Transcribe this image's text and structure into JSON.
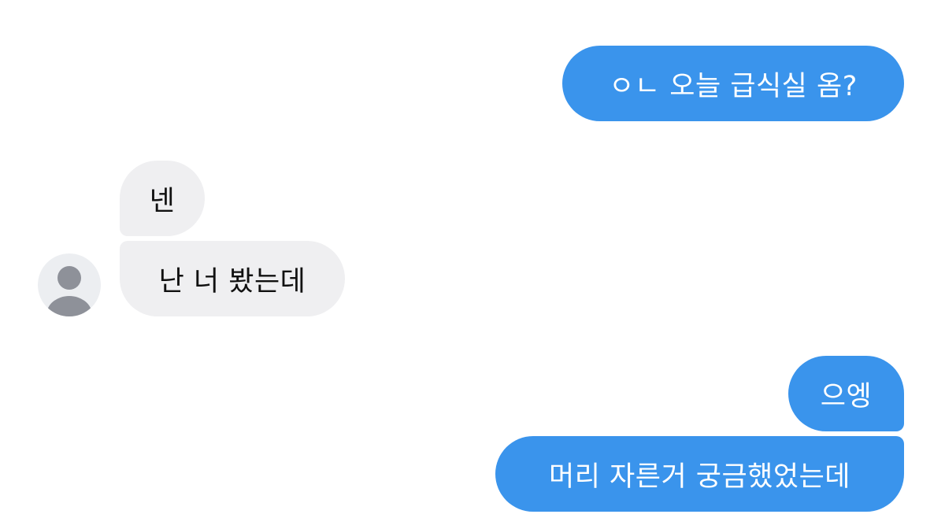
{
  "messages": [
    {
      "id": "m1",
      "direction": "sent",
      "text": "ㅇㄴ 오늘 급식실 옴?"
    },
    {
      "id": "m2",
      "direction": "received",
      "text": "넨"
    },
    {
      "id": "m3",
      "direction": "received",
      "text": "난 너 봤는데"
    },
    {
      "id": "m4",
      "direction": "sent",
      "text": "으엥"
    },
    {
      "id": "m5",
      "direction": "sent",
      "text": "머리 자른거 궁금했었는데"
    }
  ],
  "colors": {
    "sent_bubble": "#3a94ec",
    "received_bubble": "#efeff1",
    "avatar_bg": "#eceef1",
    "avatar_figure": "#8e9199"
  },
  "icons": {
    "avatar": "default-user-avatar-icon"
  }
}
